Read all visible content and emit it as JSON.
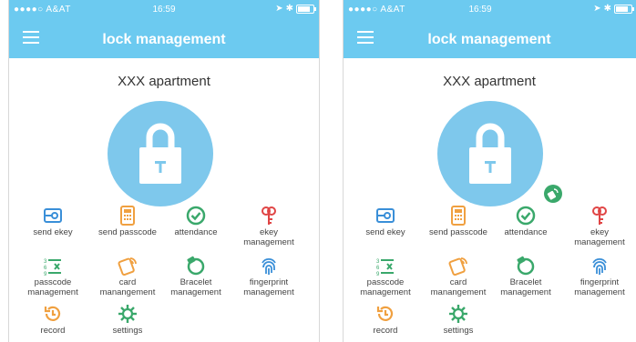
{
  "status_bar": {
    "carrier": "●●●●○ A&AT",
    "time": "16:59"
  },
  "header": {
    "title": "lock management"
  },
  "apartment_name": "XXX apartment",
  "grid_items": [
    {
      "label": "send ekey",
      "icon": "key-card-icon",
      "color": "#3a8fd8"
    },
    {
      "label": "send passcode",
      "icon": "keypad-icon",
      "color": "#f0a040"
    },
    {
      "label": "attendance",
      "icon": "check-circle-icon",
      "color": "#3aa86b"
    },
    {
      "label": "ekey management",
      "icon": "keys-icon",
      "color": "#e04545"
    },
    {
      "label": "passcode management",
      "icon": "numbered-list-icon",
      "color": "#3aa86b"
    },
    {
      "label": "card manangement",
      "icon": "card-icon",
      "color": "#f0a040"
    },
    {
      "label": "Bracelet management",
      "icon": "bracelet-icon",
      "color": "#3aa86b"
    },
    {
      "label": "fingerprint management",
      "icon": "fingerprint-icon",
      "color": "#3a8fd8"
    },
    {
      "label": "record",
      "icon": "history-icon",
      "color": "#f0a040"
    },
    {
      "label": "settings",
      "icon": "gear-icon",
      "color": "#3aa86b"
    }
  ],
  "colors": {
    "header": "#6ccaf0",
    "lock_circle": "#7ec8ec",
    "badge": "#3aa86b"
  }
}
